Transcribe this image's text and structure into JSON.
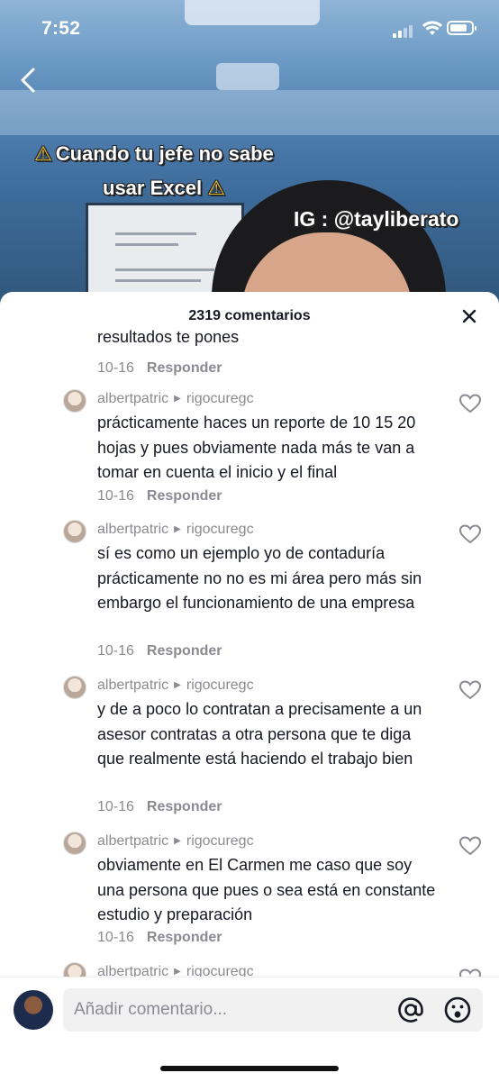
{
  "status_bar": {
    "time": "7:52"
  },
  "video": {
    "caption_line1": "Cuando tu jefe no sabe",
    "caption_line2": "usar Excel",
    "warning_glyph": "⚠",
    "handle": "IG : @tayliberato"
  },
  "comments_sheet": {
    "title": "2319 comentarios",
    "partial_comment": {
      "text": "resultados te pones",
      "date": "10-16",
      "reply_label": "Responder"
    },
    "comments": [
      {
        "user": "albertpatric",
        "reply_to": "rigocuregc",
        "text": "prácticamente haces un reporte de 10 15 20 hojas y pues obviamente nada más te van a tomar en cuenta el inicio y el final",
        "date": "10-16",
        "reply_label": "Responder"
      },
      {
        "user": "albertpatric",
        "reply_to": "rigocuregc",
        "text": "sí es como un ejemplo yo de contaduría prácticamente no no es mi área pero más sin embargo el funcionamiento de una empresa",
        "date": "10-16",
        "reply_label": "Responder"
      },
      {
        "user": "albertpatric",
        "reply_to": "rigocuregc",
        "text": "y de a poco lo contratan a precisamente a un asesor contratas a otra persona que te diga que realmente está haciendo el trabajo bien",
        "date": "10-16",
        "reply_label": "Responder"
      },
      {
        "user": "albertpatric",
        "reply_to": "rigocuregc",
        "text": "obviamente en El Carmen me caso que soy una persona que pues o sea está en constante estudio y preparación",
        "date": "10-16",
        "reply_label": "Responder"
      },
      {
        "user": "albertpatric",
        "reply_to": "rigocuregc"
      }
    ]
  },
  "input_bar": {
    "placeholder": "Añadir comentario..."
  }
}
